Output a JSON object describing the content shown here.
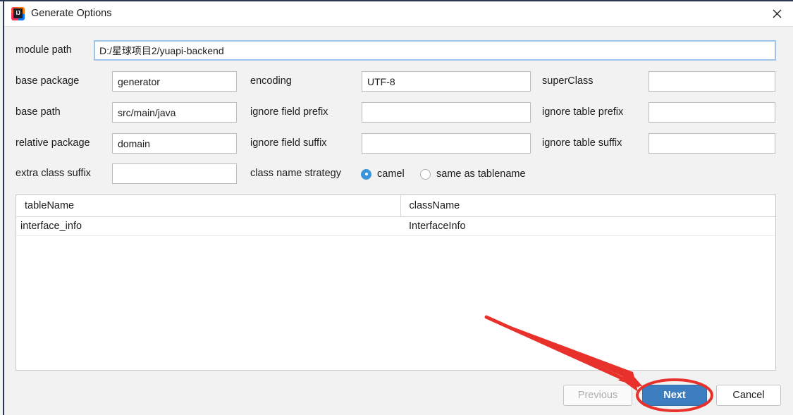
{
  "window": {
    "title": "Generate Options",
    "app_icon": "intellij-idea-icon",
    "close_icon": "close-icon"
  },
  "form": {
    "module_path": {
      "label": "module path",
      "value": "D:/星球项目2/yuapi-backend",
      "focused": true
    },
    "rows": [
      {
        "left": {
          "label": "base package",
          "value": "generator"
        },
        "middle": {
          "label": "encoding",
          "value": "UTF-8"
        },
        "right": {
          "label": "superClass",
          "value": ""
        }
      },
      {
        "left": {
          "label": "base path",
          "value": "src/main/java"
        },
        "middle": {
          "label": "ignore field prefix",
          "value": ""
        },
        "right": {
          "label": "ignore table prefix",
          "value": ""
        }
      },
      {
        "left": {
          "label": "relative package",
          "value": "domain"
        },
        "middle": {
          "label": "ignore field suffix",
          "value": ""
        },
        "right": {
          "label": "ignore table suffix",
          "value": ""
        }
      }
    ],
    "extra_class_suffix": {
      "label": "extra class suffix",
      "value": ""
    },
    "class_name_strategy": {
      "label": "class name strategy",
      "options": [
        {
          "label": "camel",
          "selected": true
        },
        {
          "label": "same as tablename",
          "selected": false
        }
      ]
    }
  },
  "table": {
    "columns": [
      "tableName",
      "className"
    ],
    "rows": [
      {
        "tableName": "interface_info",
        "className": "InterfaceInfo"
      }
    ]
  },
  "buttons": {
    "previous": {
      "label": "Previous",
      "disabled": true
    },
    "next": {
      "label": "Next",
      "primary": true,
      "highlighted": true
    },
    "cancel": {
      "label": "Cancel",
      "disabled": false
    }
  },
  "annotations": {
    "arrow_color": "#e8312b",
    "ellipse_color": "#e8312b",
    "target": "next-button"
  },
  "colors": {
    "accent": "#3c7ebf",
    "radio_selected": "#3b95d8",
    "focus_border": "#9cc4ec",
    "dialog_bg": "#f2f2f2",
    "annotation_red": "#e8312b"
  }
}
